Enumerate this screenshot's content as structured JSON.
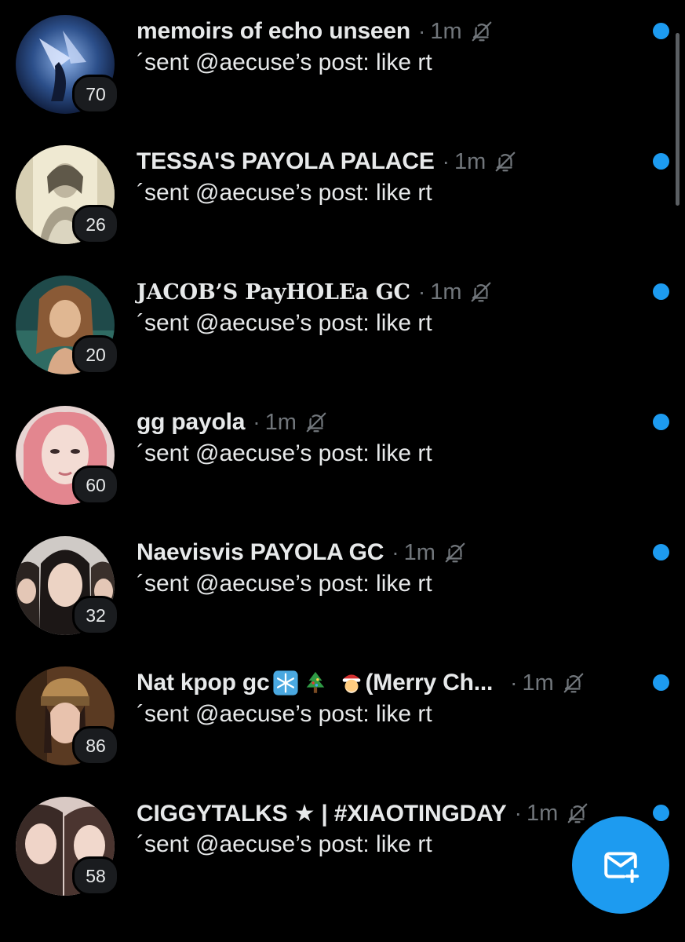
{
  "colors": {
    "background": "#000000",
    "accent": "#1d9bf0",
    "text_primary": "#e7e9ea",
    "text_secondary": "#71767b"
  },
  "conversations": [
    {
      "name": "memoirs of echo unseen",
      "time": "1m",
      "separator": "·",
      "preview": "´sent @aecuse’s post: like rt",
      "badge": "70",
      "muted": true,
      "unread": true
    },
    {
      "name": "TESSA'S PAYOLA PALACE",
      "time": "1m",
      "separator": "·",
      "preview": "´sent @aecuse’s post: like rt",
      "badge": "26",
      "muted": true,
      "unread": true
    },
    {
      "name": "JACOB’S PayHOLEa GC",
      "time": "1m",
      "separator": "·",
      "preview": "´sent @aecuse’s post: like rt",
      "badge": "20",
      "muted": true,
      "unread": true
    },
    {
      "name": "gg payola",
      "time": "1m",
      "separator": "·",
      "preview": "´sent @aecuse’s post: like rt",
      "badge": "60",
      "muted": true,
      "unread": true
    },
    {
      "name": "Naevisvis PAYOLA GC",
      "time": "1m",
      "separator": "·",
      "preview": "´sent @aecuse’s post: like rt",
      "badge": "32",
      "muted": true,
      "unread": true
    },
    {
      "name_prefix": "Nat kpop gc",
      "name_suffix": " (Merry Ch...",
      "emoji_names": [
        "snowflake-emoji",
        "christmas-tree-emoji",
        "santa-emoji"
      ],
      "time": "1m",
      "separator": "·",
      "preview": "´sent @aecuse’s post: like rt",
      "badge": "86",
      "muted": true,
      "unread": true
    },
    {
      "name": "CIGGYTALKS ★ | #XIAOTINGDAY",
      "time": "1m",
      "separator": "·",
      "preview": "´sent @aecuse’s post: like rt",
      "badge": "58",
      "muted": true,
      "unread": true
    }
  ],
  "fab": {
    "icon": "new-message-icon"
  }
}
